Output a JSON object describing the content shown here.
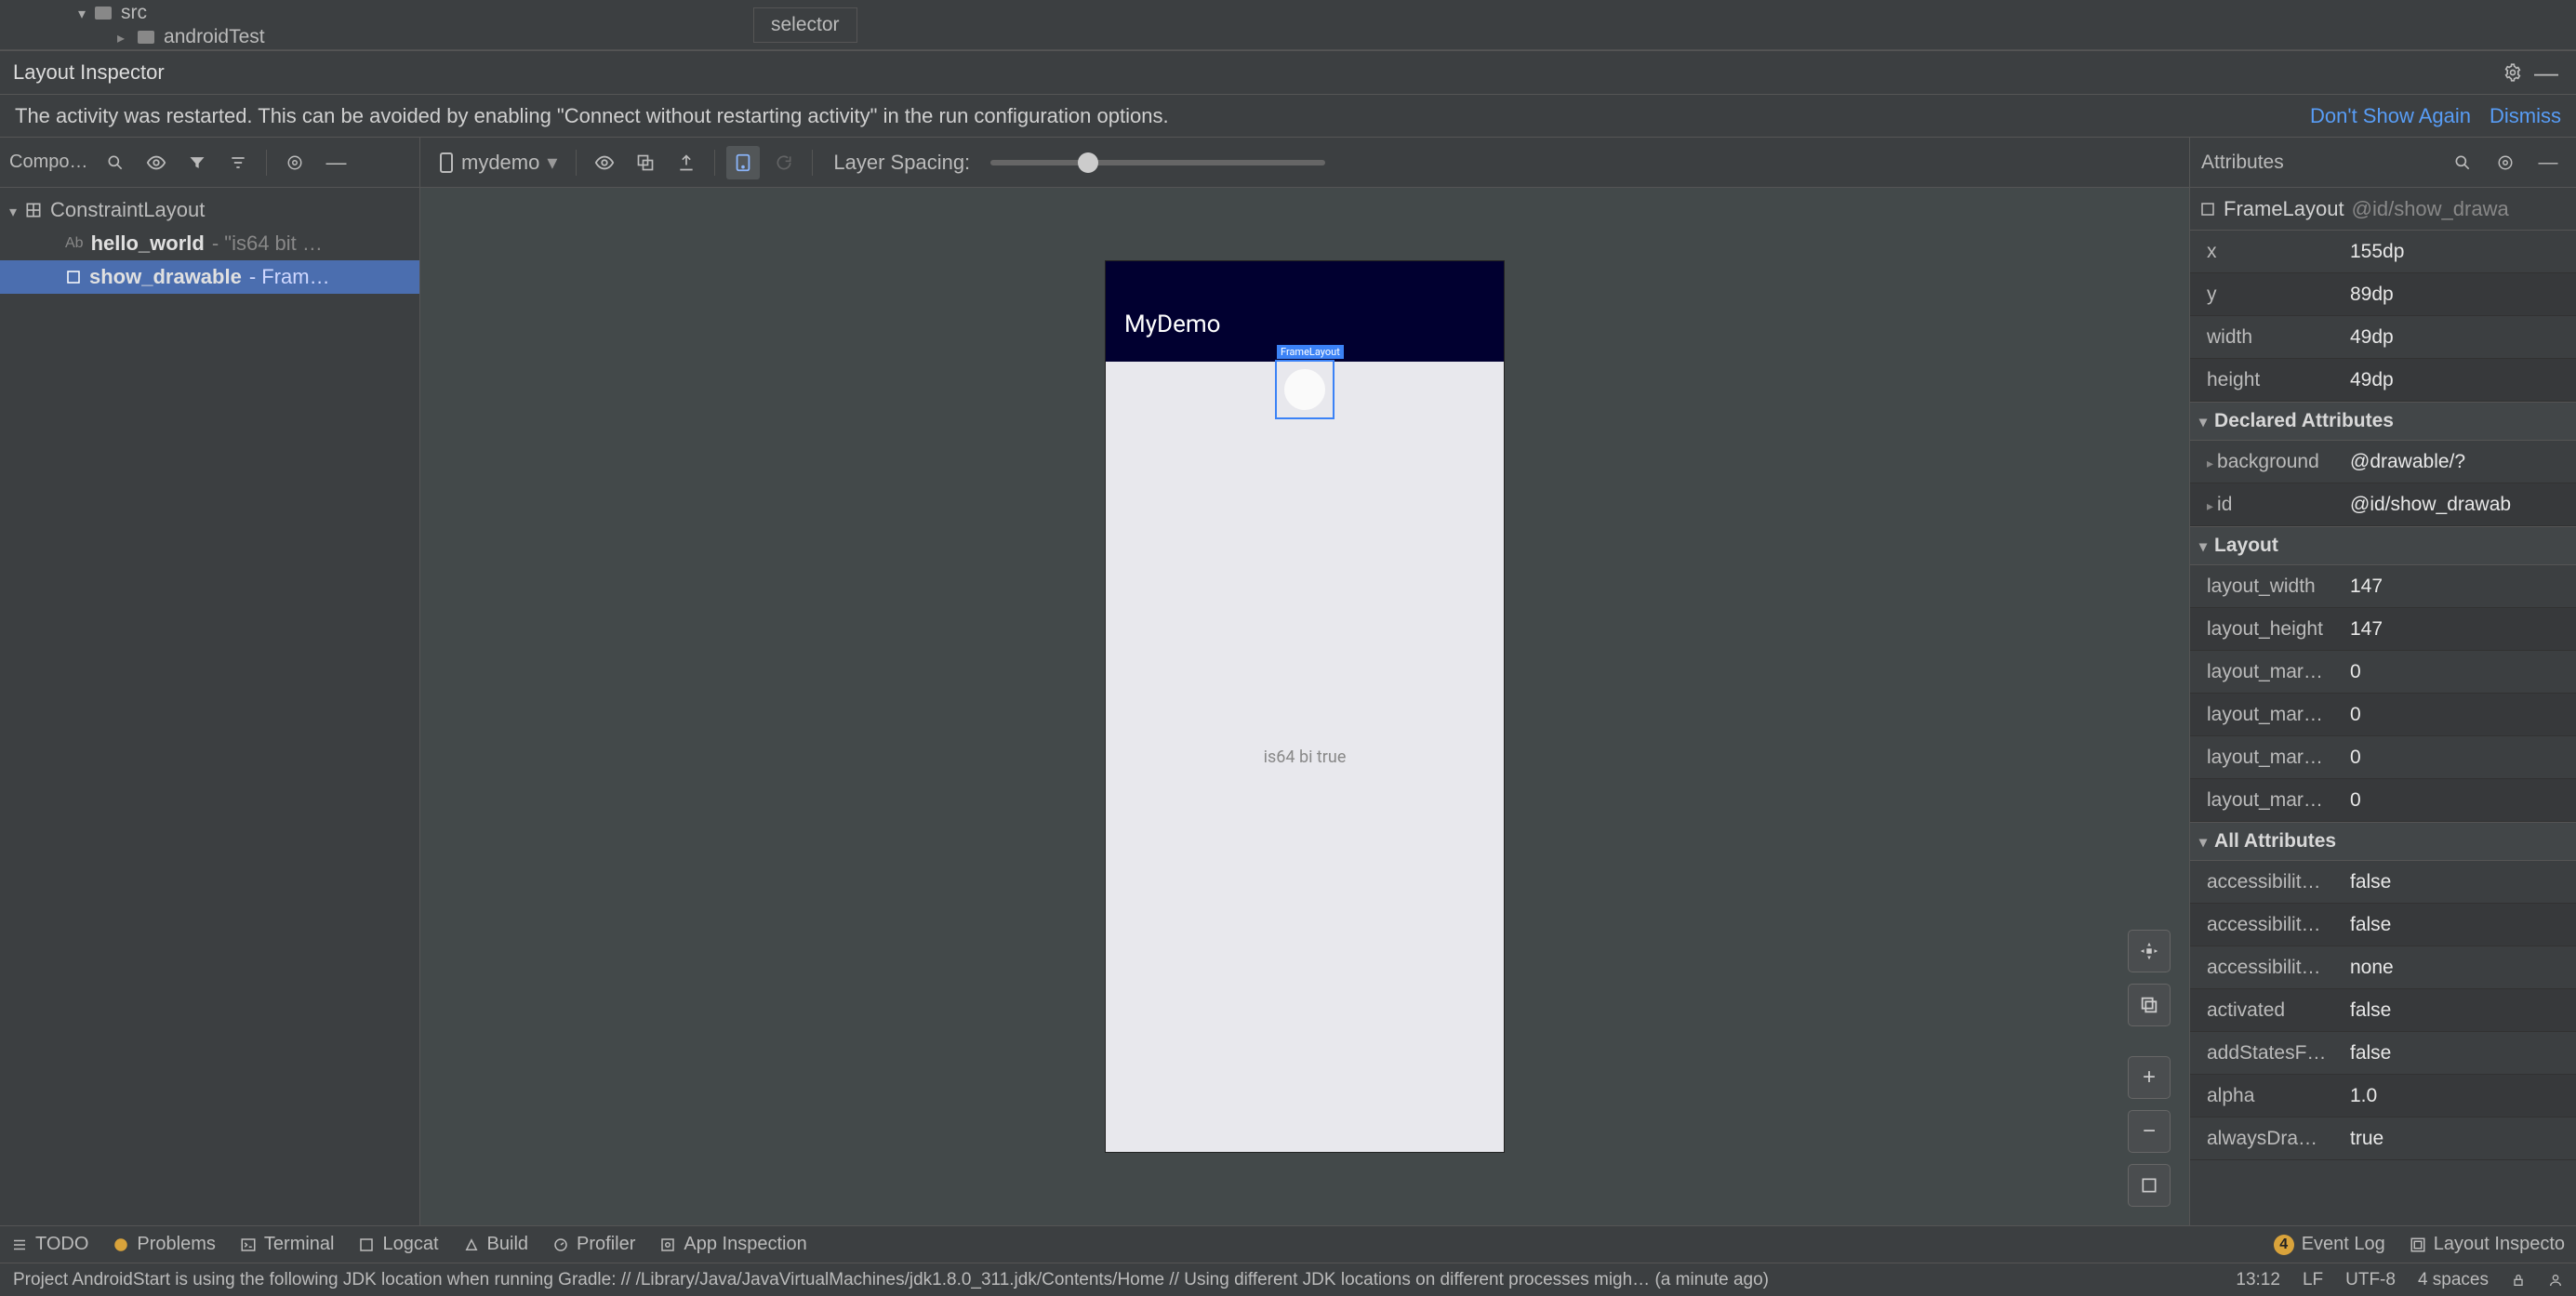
{
  "project_tree": {
    "src": "src",
    "androidTest": "androidTest"
  },
  "top_tab": "selector",
  "panel_title": "Layout Inspector",
  "notification": {
    "message": "The activity was restarted. This can be avoided by enabling \"Connect without restarting activity\" in the run configuration options.",
    "dont_show": "Don't Show Again",
    "dismiss": "Dismiss"
  },
  "comp_toolbar": {
    "label": "Compo…",
    "device": "mydemo"
  },
  "layer_spacing_label": "Layer Spacing:",
  "tree": {
    "root": "ConstraintLayout",
    "n1_name": "hello_world",
    "n1_suffix": " - \"is64 bit …",
    "n2_name": "show_drawable",
    "n2_suffix": " - Fram…"
  },
  "phone": {
    "app_title": "MyDemo",
    "center_text": "is64 bi  true"
  },
  "attributes_label": "Attributes",
  "selected": {
    "class": "FrameLayout",
    "id": "@id/show_drawa"
  },
  "sec_declared": "Declared Attributes",
  "sec_layout": "Layout",
  "sec_all": "All Attributes",
  "attrs_basic": [
    {
      "k": "x",
      "v": "155dp"
    },
    {
      "k": "y",
      "v": "89dp"
    },
    {
      "k": "width",
      "v": "49dp"
    },
    {
      "k": "height",
      "v": "49dp"
    }
  ],
  "attrs_declared": [
    {
      "k": "background",
      "v": "@drawable/?"
    },
    {
      "k": "id",
      "v": "@id/show_drawab"
    }
  ],
  "attrs_layout": [
    {
      "k": "layout_width",
      "v": "147"
    },
    {
      "k": "layout_height",
      "v": "147"
    },
    {
      "k": "layout_mar…",
      "v": "0"
    },
    {
      "k": "layout_mar…",
      "v": "0"
    },
    {
      "k": "layout_mar…",
      "v": "0"
    },
    {
      "k": "layout_mar…",
      "v": "0"
    }
  ],
  "attrs_all": [
    {
      "k": "accessibilit…",
      "v": "false"
    },
    {
      "k": "accessibilit…",
      "v": "false"
    },
    {
      "k": "accessibilit…",
      "v": "none"
    },
    {
      "k": "activated",
      "v": "false"
    },
    {
      "k": "addStatesF…",
      "v": "false"
    },
    {
      "k": "alpha",
      "v": "1.0"
    },
    {
      "k": "alwaysDra…",
      "v": "true"
    }
  ],
  "bottom": {
    "todo": "TODO",
    "problems": "Problems",
    "terminal": "Terminal",
    "logcat": "Logcat",
    "build": "Build",
    "profiler": "Profiler",
    "appinsp": "App Inspection",
    "eventlog_badge": "4",
    "eventlog": "Event Log",
    "layoutinsp": "Layout Inspecto"
  },
  "status": {
    "msg": "Project AndroidStart is using the following JDK location when running Gradle: // /Library/Java/JavaVirtualMachines/jdk1.8.0_311.jdk/Contents/Home // Using different JDK locations on different processes migh… (a minute ago)",
    "time": "13:12",
    "le": "LF",
    "enc": "UTF-8",
    "spaces": "4 spaces"
  }
}
